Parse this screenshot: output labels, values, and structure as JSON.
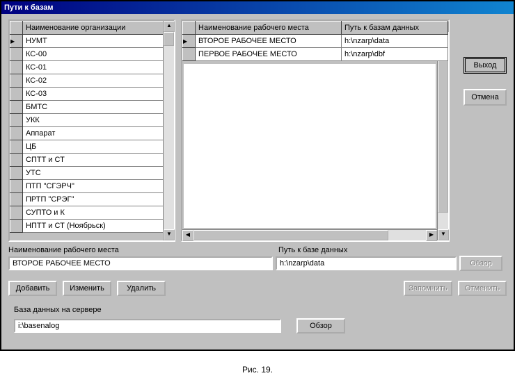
{
  "title": "Пути к базам",
  "leftTable": {
    "header": "Наименование организации",
    "rows": [
      "НУМТ",
      "КС-00",
      "КС-01",
      "КС-02",
      "КС-03",
      "БМТС",
      "УКК",
      "Аппарат",
      "ЦБ",
      "СПТТ и СТ",
      "УТС",
      "ПТП \"СГЭРЧ\"",
      "ПРТП \"СРЭГ\"",
      "СУПТО и К",
      "НПТТ и СТ (Ноябрьск)"
    ],
    "activeIndex": 0
  },
  "rightTable": {
    "headers": [
      "Наименование рабочего места",
      "Путь к базам данных"
    ],
    "rows": [
      [
        "ВТОРОЕ РАБОЧЕЕ МЕСТО",
        "h:\\nzarp\\data"
      ],
      [
        "ПЕРВОЕ РАБОЧЕЕ МЕСТО",
        "h:\\nzarp\\dbf"
      ]
    ],
    "activeIndex": 0
  },
  "sideButtons": {
    "exit": "Выход",
    "cancel": "Отмена"
  },
  "fields": {
    "workplaceLabel": "Наименование рабочего места",
    "workplaceValue": "ВТОРОЕ РАБОЧЕЕ МЕСТО",
    "pathLabel": "Путь к базе данных",
    "pathValue": "h:\\nzarp\\data",
    "browse": "Обзор"
  },
  "actions": {
    "add": "Добавить",
    "edit": "Изменить",
    "delete": "Удалить",
    "remember": "Запомнить",
    "undo": "Отменить"
  },
  "server": {
    "label": "База данных на сервере",
    "value": "i:\\basenalog",
    "browse": "Обзор"
  },
  "caption": "Рис. 19."
}
